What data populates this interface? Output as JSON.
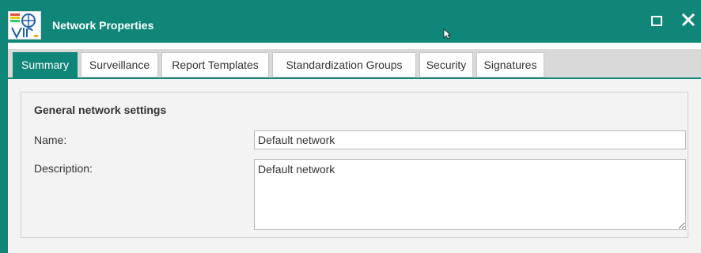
{
  "window": {
    "title": "Network Properties",
    "colors": {
      "accent": "#0f8678",
      "tab_inactive_bg": "#ffffff",
      "panel_bg": "#f3f3f3",
      "tabstrip_bg": "#d9d9d9"
    }
  },
  "tabs": [
    {
      "label": "Summary",
      "active": true
    },
    {
      "label": "Surveillance",
      "active": false
    },
    {
      "label": "Report Templates",
      "active": false
    },
    {
      "label": "Standardization Groups",
      "active": false
    },
    {
      "label": "Security",
      "active": false
    },
    {
      "label": "Signatures",
      "active": false
    }
  ],
  "summary": {
    "group_title": "General network settings",
    "name_label": "Name:",
    "name_value": "Default network",
    "description_label": "Description:",
    "description_value": "Default network"
  },
  "icons": {
    "app": "app-logo-icon",
    "maximize": "maximize-icon",
    "close": "close-icon",
    "cursor": "mouse-cursor-icon"
  }
}
